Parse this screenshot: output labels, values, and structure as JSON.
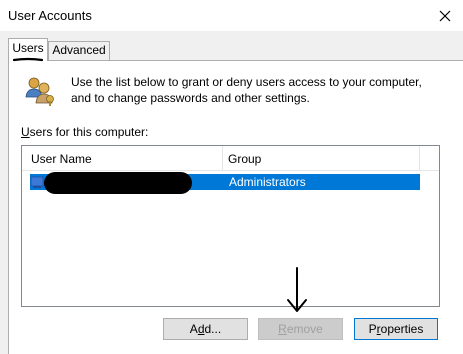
{
  "window": {
    "title": "User Accounts"
  },
  "tabs": [
    {
      "label": "Users",
      "selected": true
    },
    {
      "label": "Advanced",
      "selected": false
    }
  ],
  "description": {
    "line1": "Use the list below to grant or deny users access to your computer,",
    "line2": "and to change passwords and other settings."
  },
  "list": {
    "label_prefix": "U",
    "label_rest": "sers for this computer:",
    "columns": [
      "User Name",
      "Group"
    ],
    "rows": [
      {
        "user_name": "",
        "group": "Administrators",
        "selected": true
      }
    ]
  },
  "buttons": {
    "add_prefix": "A",
    "add_underlined": "d",
    "add_rest": "d...",
    "remove_prefix": "",
    "remove_underlined": "R",
    "remove_rest": "emove",
    "properties_prefix": "P",
    "properties_underlined": "r",
    "properties_rest": "operties"
  },
  "colors": {
    "selection": "#0078d7",
    "window_bg": "#f0f0f0"
  },
  "icons": [
    "close-icon",
    "users-icon",
    "user-icon",
    "arrow-down-annotation"
  ]
}
